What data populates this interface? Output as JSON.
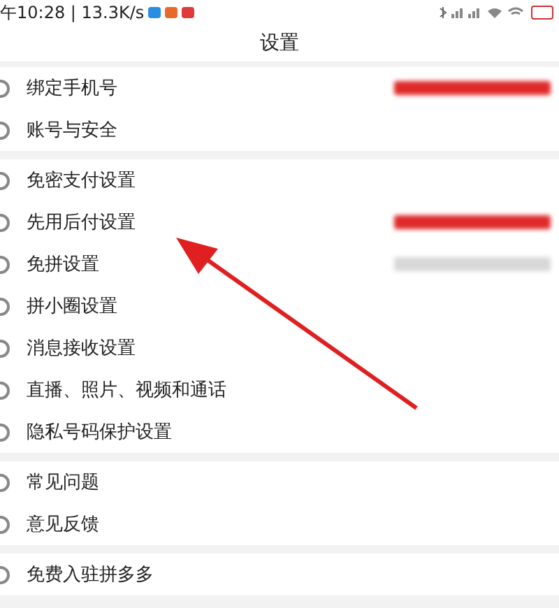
{
  "status_bar": {
    "time_speed": "午10:28 | 13.3K/s"
  },
  "header": {
    "title": "设置"
  },
  "groups": [
    {
      "items": [
        {
          "label": "绑定手机号",
          "color": "#e02a2a"
        },
        {
          "label": "账号与安全"
        }
      ]
    },
    {
      "items": [
        {
          "label": "免密支付设置"
        },
        {
          "label": "先用后付设置",
          "color": "#e02a2a"
        },
        {
          "label": "免拼设置",
          "color": "#d8d8d8"
        },
        {
          "label": "拼小圈设置"
        },
        {
          "label": "消息接收设置"
        },
        {
          "label": "直播、照片、视频和通话"
        },
        {
          "label": "隐私号码保护设置"
        }
      ]
    },
    {
      "items": [
        {
          "label": "常见问题"
        },
        {
          "label": "意见反馈"
        }
      ]
    },
    {
      "items": [
        {
          "label": "免费入驻拼多多"
        }
      ]
    }
  ],
  "annotation": {
    "kind": "arrow"
  }
}
